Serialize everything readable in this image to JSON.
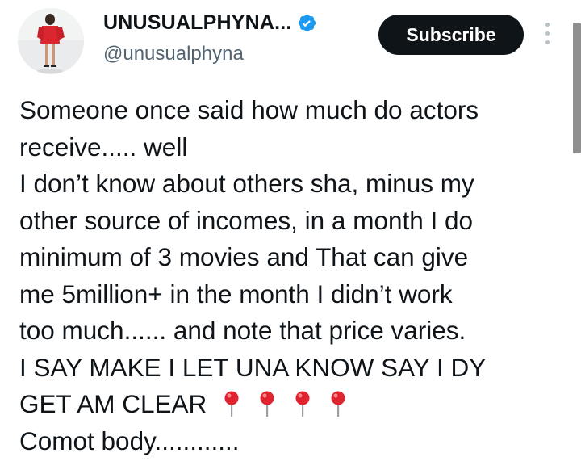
{
  "author": {
    "display_name": "UNUSUALPHYNA...",
    "handle": "@unusualphyna",
    "avatar_icon": "avatar-photo",
    "verified_icon": "verified-badge-icon",
    "verified_color": "#1d9bf0"
  },
  "actions": {
    "subscribe_label": "Subscribe",
    "more_icon": "more-vertical-icon"
  },
  "tweet": {
    "lines": [
      "Someone once said how much do actors",
      "receive..... well",
      "I don’t know about others sha, minus my",
      "other source of incomes, in a month I do",
      "minimum of 3 movies and That can give",
      "me 5million+ in the month I didn’t work",
      "too much...... and note that price varies.",
      "I SAY MAKE I LET UNA KNOW SAY I DY",
      "GET AM CLEAR",
      "Comot body............"
    ],
    "emoji_icon": "round-pushpin-icon",
    "emoji_count": 4,
    "emoji_color": "#e0242f"
  }
}
